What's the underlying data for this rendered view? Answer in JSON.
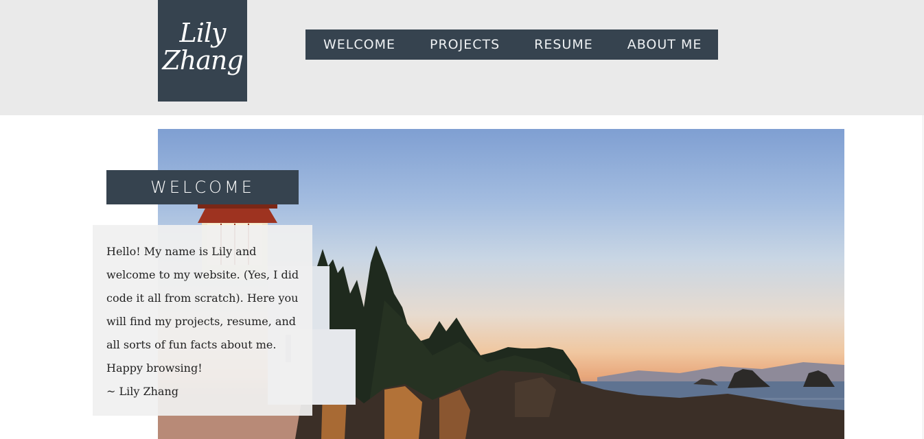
{
  "site": {
    "logo_line1": "Lily",
    "logo_line2": "Zhang"
  },
  "nav": {
    "items": [
      {
        "label": "WELCOME"
      },
      {
        "label": "PROJECTS"
      },
      {
        "label": "RESUME"
      },
      {
        "label": "ABOUT ME"
      }
    ]
  },
  "welcome": {
    "heading": "WELCOME",
    "body": "Hello! My name is Lily and welcome to my website. (Yes, I did code it all from scratch). Here you will find my projects, resume, and all sorts of fun facts about me. Happy browsing!",
    "signature": "~ Lily Zhang"
  },
  "colors": {
    "header_bg": "#eaeaea",
    "accent": "#36434f",
    "panel_bg": "#f0f0f0"
  }
}
